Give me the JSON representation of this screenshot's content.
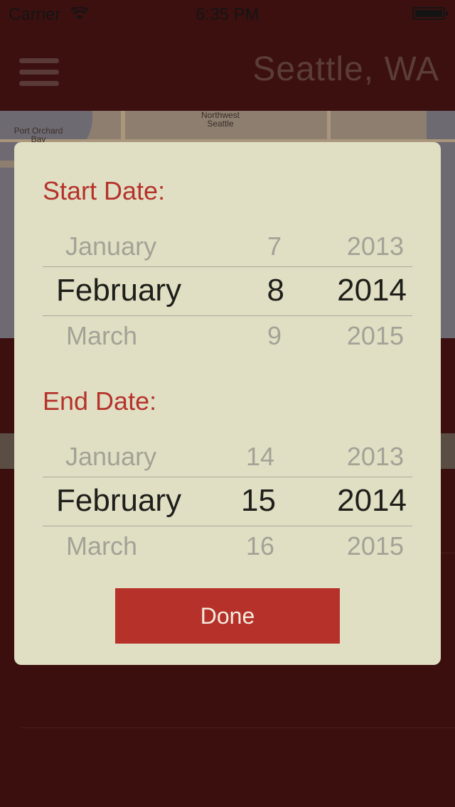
{
  "status_bar": {
    "carrier": "Carrier",
    "time": "6:35 PM",
    "wifi_icon": "wifi-icon",
    "battery_icon": "battery-icon"
  },
  "navbar": {
    "menu_icon": "hamburger-menu-icon",
    "title": "Seattle, WA"
  },
  "map": {
    "labels": [
      "Northwest Seattle",
      "Port Orchard Bay"
    ]
  },
  "date_modal": {
    "start": {
      "label": "Start Date:",
      "month": {
        "prev": "January",
        "selected": "February",
        "next": "March"
      },
      "day": {
        "prev": "7",
        "selected": "8",
        "next": "9"
      },
      "year": {
        "prev": "2013",
        "selected": "2014",
        "next": "2015"
      }
    },
    "end": {
      "label": "End Date:",
      "month": {
        "prev": "January",
        "selected": "February",
        "next": "March"
      },
      "day": {
        "prev": "14",
        "selected": "15",
        "next": "16"
      },
      "year": {
        "prev": "2013",
        "selected": "2014",
        "next": "2015"
      }
    },
    "done_label": "Done"
  },
  "colors": {
    "accent": "#b5312a",
    "modal_bg": "#e0dfc4",
    "app_bg": "#3a0f0e"
  }
}
